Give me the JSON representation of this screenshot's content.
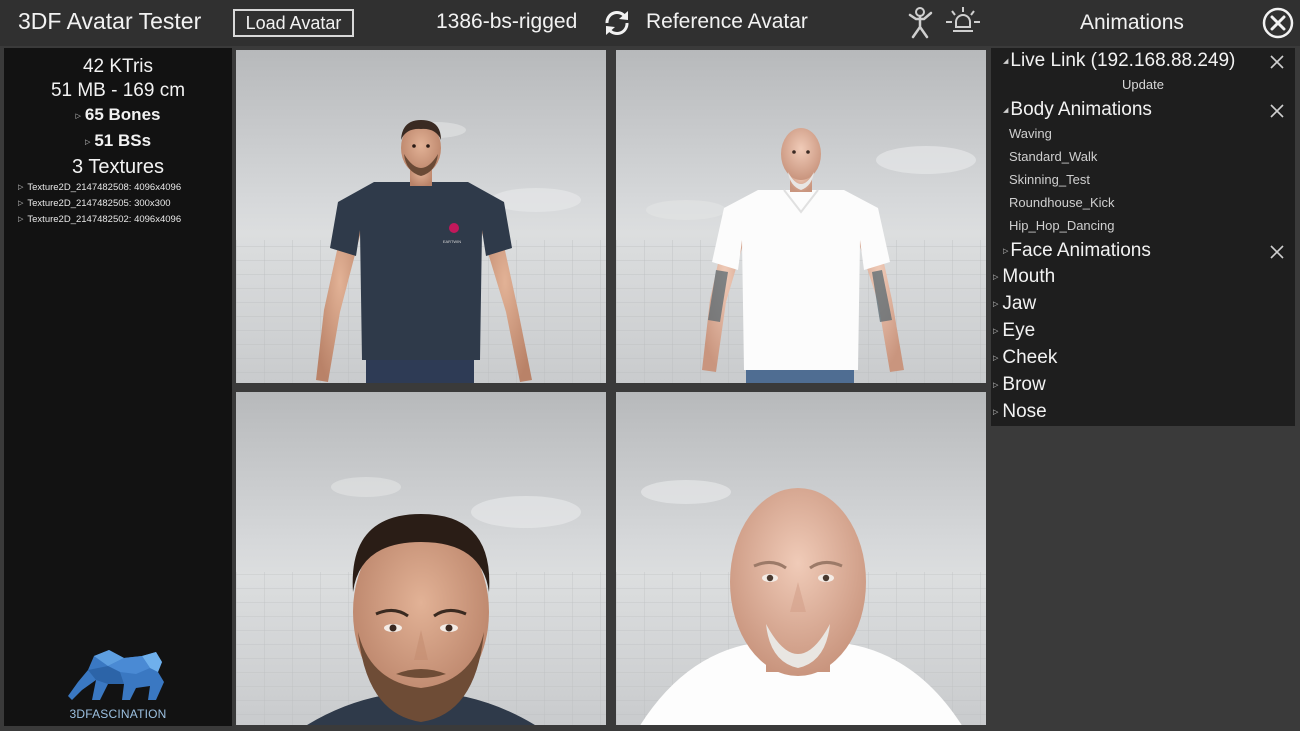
{
  "topbar": {
    "title": "3DF Avatar Tester",
    "load_button": "Load Avatar",
    "avatar_name": "1386-bs-rigged",
    "reference_label": "Reference Avatar",
    "animations_title": "Animations"
  },
  "stats": {
    "ktris": "42 KTris",
    "size_height": "51 MB - 169 cm",
    "bones": "65 Bones",
    "blendshapes": "51 BSs",
    "textures_count": "3 Textures",
    "textures": [
      "Texture2D_2147482508: 4096x4096",
      "Texture2D_2147482505: 300x300",
      "Texture2D_2147482502: 4096x4096"
    ],
    "logo_text": "3DFASCINATION"
  },
  "shirt_logo": "EARTWIN",
  "animations": {
    "live_link": "Live Link (192.168.88.249)",
    "update": "Update",
    "body_header": "Body Animations",
    "body_items": [
      "Waving",
      "Standard_Walk",
      "Skinning_Test",
      "Roundhouse_Kick",
      "Hip_Hop_Dancing"
    ],
    "face_header": "Face Animations",
    "face_groups": [
      "Mouth",
      "Jaw",
      "Eye",
      "Cheek",
      "Brow",
      "Nose"
    ]
  },
  "icons": {
    "refresh": "refresh-icon",
    "ragdoll": "ragdoll-icon",
    "light": "light-icon",
    "close": "close-icon",
    "collapse": "close-x-icon"
  },
  "colors": {
    "topbar": "#303030",
    "panel_dark": "#121212",
    "panel_right": "#1e1e1e",
    "shirt_navy": "#2f3a4a",
    "shirt_white": "#ffffff",
    "logo_blue": "#4a90d9"
  }
}
